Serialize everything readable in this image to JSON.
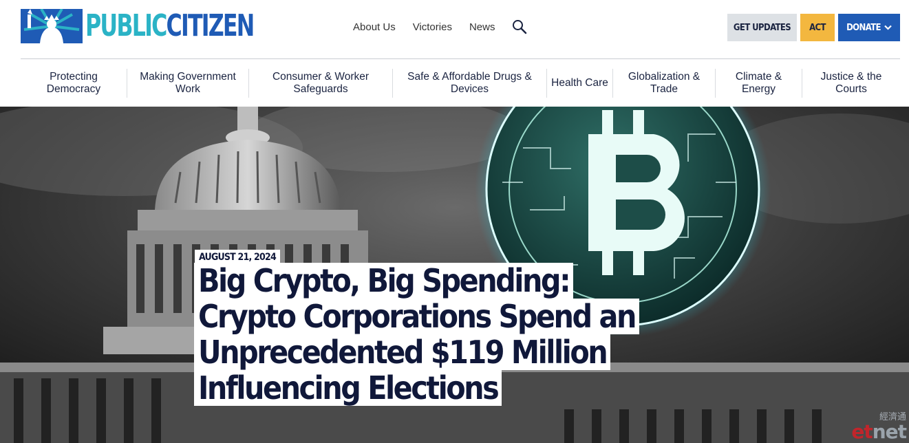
{
  "brand": {
    "name_part1": "PUBLIC",
    "name_part2": "CITIZEN",
    "colors": {
      "teal": "#2bb3c6",
      "blue": "#1f5bb5",
      "navy": "#10183a",
      "gold": "#f3b73f"
    }
  },
  "utility_nav": {
    "links": [
      "About Us",
      "Victories",
      "News"
    ],
    "search_icon": "search-icon"
  },
  "cta": {
    "updates": "GET UPDATES",
    "act": "ACT",
    "donate": "DONATE"
  },
  "main_nav": {
    "items": [
      "Protecting Democracy",
      "Making Government Work",
      "Consumer & Worker Safeguards",
      "Safe & Affordable Drugs & Devices",
      "Health Care",
      "Globalization & Trade",
      "Climate & Energy",
      "Justice & the Courts"
    ]
  },
  "hero": {
    "date": "AUGUST 21, 2024",
    "headline_lines": [
      "Big Crypto, Big Spending:",
      "Crypto Corporations Spend an",
      "Unprecedented $119 Million",
      "Influencing Elections"
    ]
  },
  "watermark": {
    "chinese": "經濟通",
    "logo_a": "et",
    "logo_b": "net"
  }
}
